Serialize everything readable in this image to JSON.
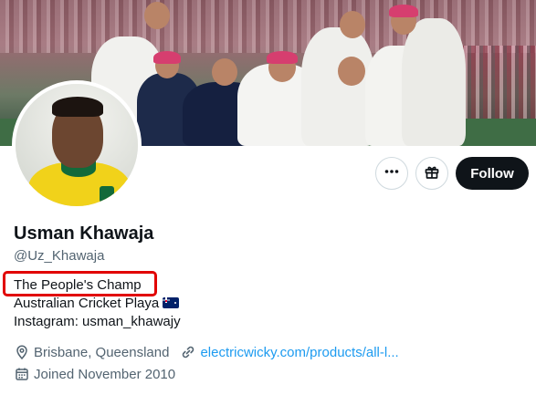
{
  "profile": {
    "name": "Usman Khawaja",
    "handle": "@Uz_Khawaja",
    "bio_lines": [
      "The People's Champ",
      "Australian Cricket Playa",
      "Instagram: usman_khawajy"
    ],
    "location": "Brisbane, Queensland",
    "website": "electricwicky.com/products/all-l...",
    "joined": "Joined November 2010"
  },
  "actions": {
    "follow_label": "Follow"
  },
  "colors": {
    "link": "#1d9bf0",
    "highlight": "#e10000",
    "follow_bg": "#0f1419"
  },
  "icons": {
    "more": "more-icon",
    "subscribe": "gift-icon",
    "location": "location-pin-icon",
    "link": "link-icon",
    "calendar": "calendar-icon"
  }
}
